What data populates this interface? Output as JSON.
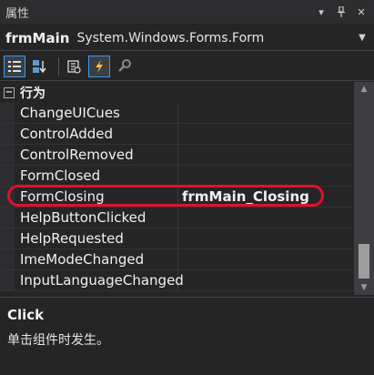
{
  "window": {
    "title": "属性"
  },
  "object_selector": {
    "name": "frmMain",
    "type": "System.Windows.Forms.Form"
  },
  "category": {
    "label": "行为"
  },
  "events": [
    {
      "name": "ChangeUICues",
      "value": ""
    },
    {
      "name": "ControlAdded",
      "value": ""
    },
    {
      "name": "ControlRemoved",
      "value": ""
    },
    {
      "name": "FormClosed",
      "value": ""
    },
    {
      "name": "FormClosing",
      "value": "frmMain_Closing"
    },
    {
      "name": "HelpButtonClicked",
      "value": ""
    },
    {
      "name": "HelpRequested",
      "value": ""
    },
    {
      "name": "ImeModeChanged",
      "value": ""
    },
    {
      "name": "InputLanguageChanged",
      "value": ""
    }
  ],
  "description": {
    "name": "Click",
    "text": "单击组件时发生。"
  },
  "colors": {
    "highlight": "#e0112b",
    "accent": "#3399ff",
    "background": "#252526"
  }
}
